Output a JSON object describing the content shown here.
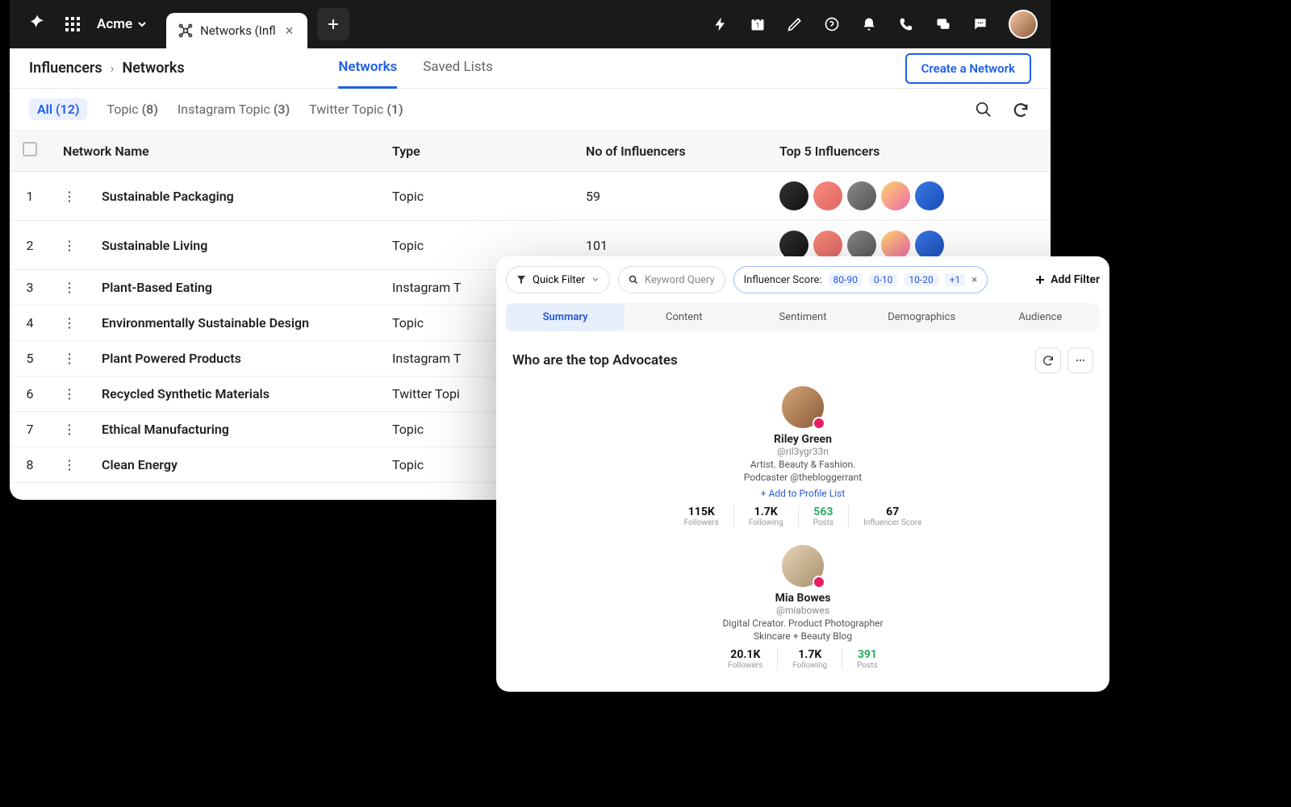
{
  "topbar": {
    "workspace": "Acme",
    "tab_title": "Networks (Infl",
    "icons": [
      "bolt",
      "calendar",
      "edit",
      "help",
      "bell",
      "phone",
      "chat",
      "message"
    ]
  },
  "breadcrumb": {
    "root": "Influencers",
    "current": "Networks"
  },
  "sub_tabs": {
    "networks": "Networks",
    "saved": "Saved Lists"
  },
  "create_button": "Create a Network",
  "filters": [
    {
      "label": "All",
      "count": "(12)",
      "active": true
    },
    {
      "label": "Topic",
      "count": "(8)",
      "active": false
    },
    {
      "label": "Instagram Topic",
      "count": "(3)",
      "active": false
    },
    {
      "label": "Twitter Topic",
      "count": "(1)",
      "active": false
    }
  ],
  "table": {
    "headers": {
      "name": "Network Name",
      "type": "Type",
      "count": "No of Influencers",
      "top": "Top 5 Influencers"
    },
    "rows": [
      {
        "idx": "1",
        "name": "Sustainable Packaging",
        "type": "Topic",
        "count": "59",
        "avatars": 5
      },
      {
        "idx": "2",
        "name": "Sustainable Living",
        "type": "Topic",
        "count": "101",
        "avatars": 5
      },
      {
        "idx": "3",
        "name": "Plant-Based Eating",
        "type": "Instagram T",
        "count": "",
        "avatars": 0
      },
      {
        "idx": "4",
        "name": "Environmentally Sustainable Design",
        "type": "Topic",
        "count": "",
        "avatars": 0
      },
      {
        "idx": "5",
        "name": "Plant Powered Products",
        "type": "Instagram T",
        "count": "",
        "avatars": 0
      },
      {
        "idx": "6",
        "name": "Recycled Synthetic Materials",
        "type": "Twitter Topi",
        "count": "",
        "avatars": 0
      },
      {
        "idx": "7",
        "name": "Ethical Manufacturing",
        "type": "Topic",
        "count": "",
        "avatars": 0
      },
      {
        "idx": "8",
        "name": "Clean Energy",
        "type": "Topic",
        "count": "",
        "avatars": 0
      }
    ]
  },
  "overlay": {
    "quick_filter": "Quick Filter",
    "keyword_query": "Keyword Query",
    "score_label": "Influencer Score:",
    "score_chips": [
      "80-90",
      "0-10",
      "10-20",
      "+1"
    ],
    "add_filter": "Add Filter",
    "tabs": [
      "Summary",
      "Content",
      "Sentiment",
      "Demographics",
      "Audience"
    ],
    "section_title": "Who are the top Advocates",
    "add_to_list": "+ Add to Profile List",
    "advocates": [
      {
        "name": "Riley Green",
        "handle": "@ril3ygr33n",
        "bio1": "Artist. Beauty & Fashion.",
        "bio2": "Podcaster @thebloggerrant",
        "stats": [
          {
            "v": "115K",
            "l": "Followers"
          },
          {
            "v": "1.7K",
            "l": "Following"
          },
          {
            "v": "563",
            "l": "Posts",
            "green": true
          },
          {
            "v": "67",
            "l": "Influencer Score"
          }
        ]
      },
      {
        "name": "Mia Bowes",
        "handle": "@miabowes",
        "bio1": "Digital Creator. Product Photographer",
        "bio2": "Skincare + Beauty Blog",
        "stats": [
          {
            "v": "20.1K",
            "l": "Followers"
          },
          {
            "v": "1.7K",
            "l": "Following"
          },
          {
            "v": "391",
            "l": "Posts",
            "green": true
          }
        ]
      }
    ]
  }
}
